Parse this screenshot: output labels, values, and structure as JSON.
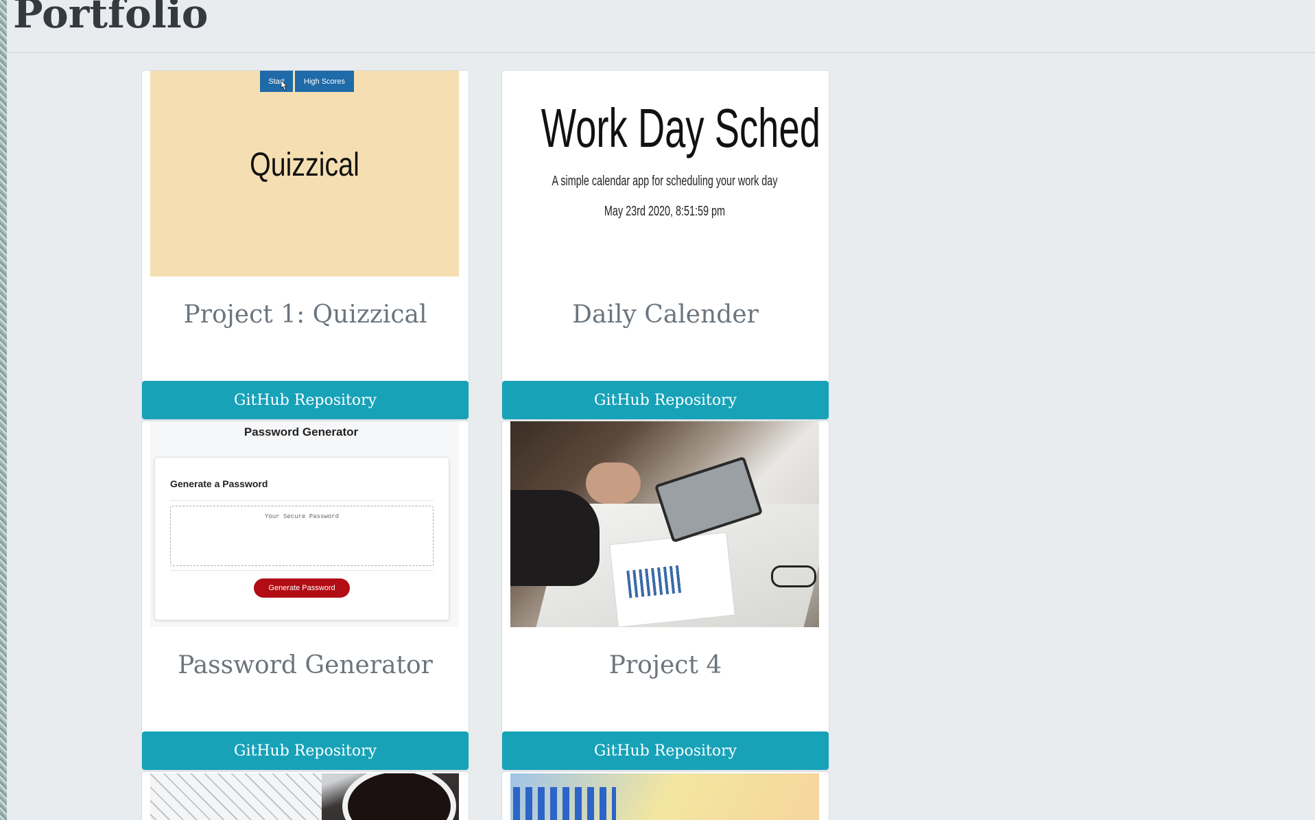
{
  "page": {
    "title": "Portfolio"
  },
  "projects": [
    {
      "title": "Project 1: Quizzical",
      "button": "GitHub Repository",
      "thumb": {
        "start": "Start",
        "high_scores": "High Scores",
        "heading": "Quizzical"
      }
    },
    {
      "title": "Daily Calender",
      "button": "GitHub Repository",
      "thumb": {
        "heading": "Work Day Scheduler",
        "subheading": "A simple calendar app for scheduling your work day",
        "date": "May 23rd 2020, 8:51:59 pm"
      }
    },
    {
      "title": "Password Generator",
      "button": "GitHub Repository",
      "thumb": {
        "heading": "Password Generator",
        "panel_title": "Generate a Password",
        "placeholder": "Your Secure Password",
        "generate": "Generate Password"
      }
    },
    {
      "title": "Project 4",
      "button": "GitHub Repository"
    }
  ],
  "colors": {
    "accent_button": "#17a2b8",
    "generate_button": "#b20d14",
    "quiz_background": "#f5dfb2",
    "quiz_buttons": "#1f6aa8"
  }
}
